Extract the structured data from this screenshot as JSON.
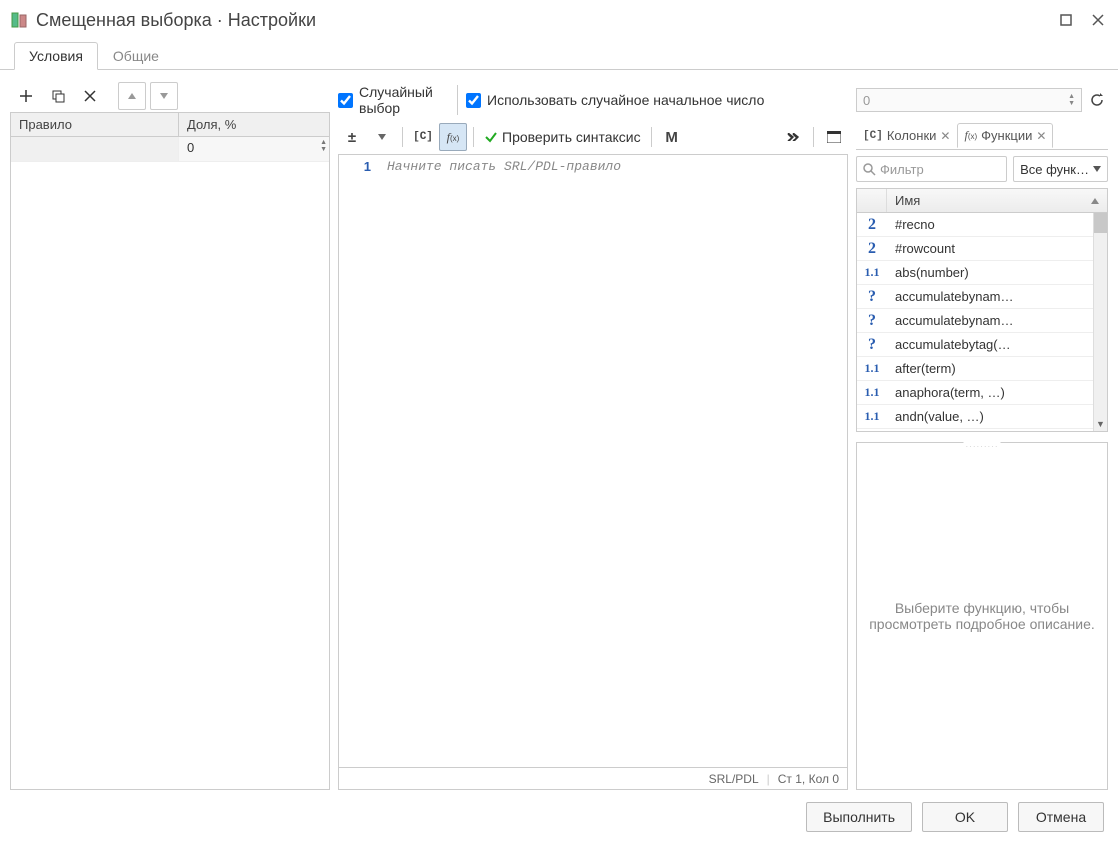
{
  "window": {
    "title": "Смещенная выборка · Настройки"
  },
  "tabs": {
    "conditions": "Условия",
    "general": "Общие"
  },
  "left": {
    "col_rule": "Правило",
    "col_share": "Доля, %",
    "row_share_value": "0"
  },
  "options": {
    "random_select": "Случайный выбор",
    "use_seed": "Использовать случайное начальное число",
    "seed_value": "0"
  },
  "mid_toolbar": {
    "check_syntax": "Проверить синтаксис"
  },
  "editor": {
    "line_no": "1",
    "placeholder": "Начните писать SRL/PDL-правило",
    "status_lang": "SRL/PDL",
    "status_pos": "Ст 1, Кол 0"
  },
  "right": {
    "tab_columns": "Колонки",
    "tab_functions": "Функции",
    "filter_placeholder": "Фильтр",
    "combo_label": "Все функ…",
    "col_name": "Имя",
    "desc_placeholder": "Выберите функцию, чтобы просмотреть подробное описание.",
    "functions": [
      {
        "icon": "int",
        "name": "#recno"
      },
      {
        "icon": "int",
        "name": "#rowcount"
      },
      {
        "icon": "dec",
        "name": "abs(number)"
      },
      {
        "icon": "q",
        "name": "accumulatebynam…"
      },
      {
        "icon": "q",
        "name": "accumulatebynam…"
      },
      {
        "icon": "q",
        "name": "accumulatebytag(…"
      },
      {
        "icon": "dec",
        "name": "after(term)"
      },
      {
        "icon": "dec",
        "name": "anaphora(term, …)"
      },
      {
        "icon": "dec",
        "name": "andn(value, …)"
      }
    ]
  },
  "footer": {
    "run": "Выполнить",
    "ok": "OK",
    "cancel": "Отмена"
  }
}
